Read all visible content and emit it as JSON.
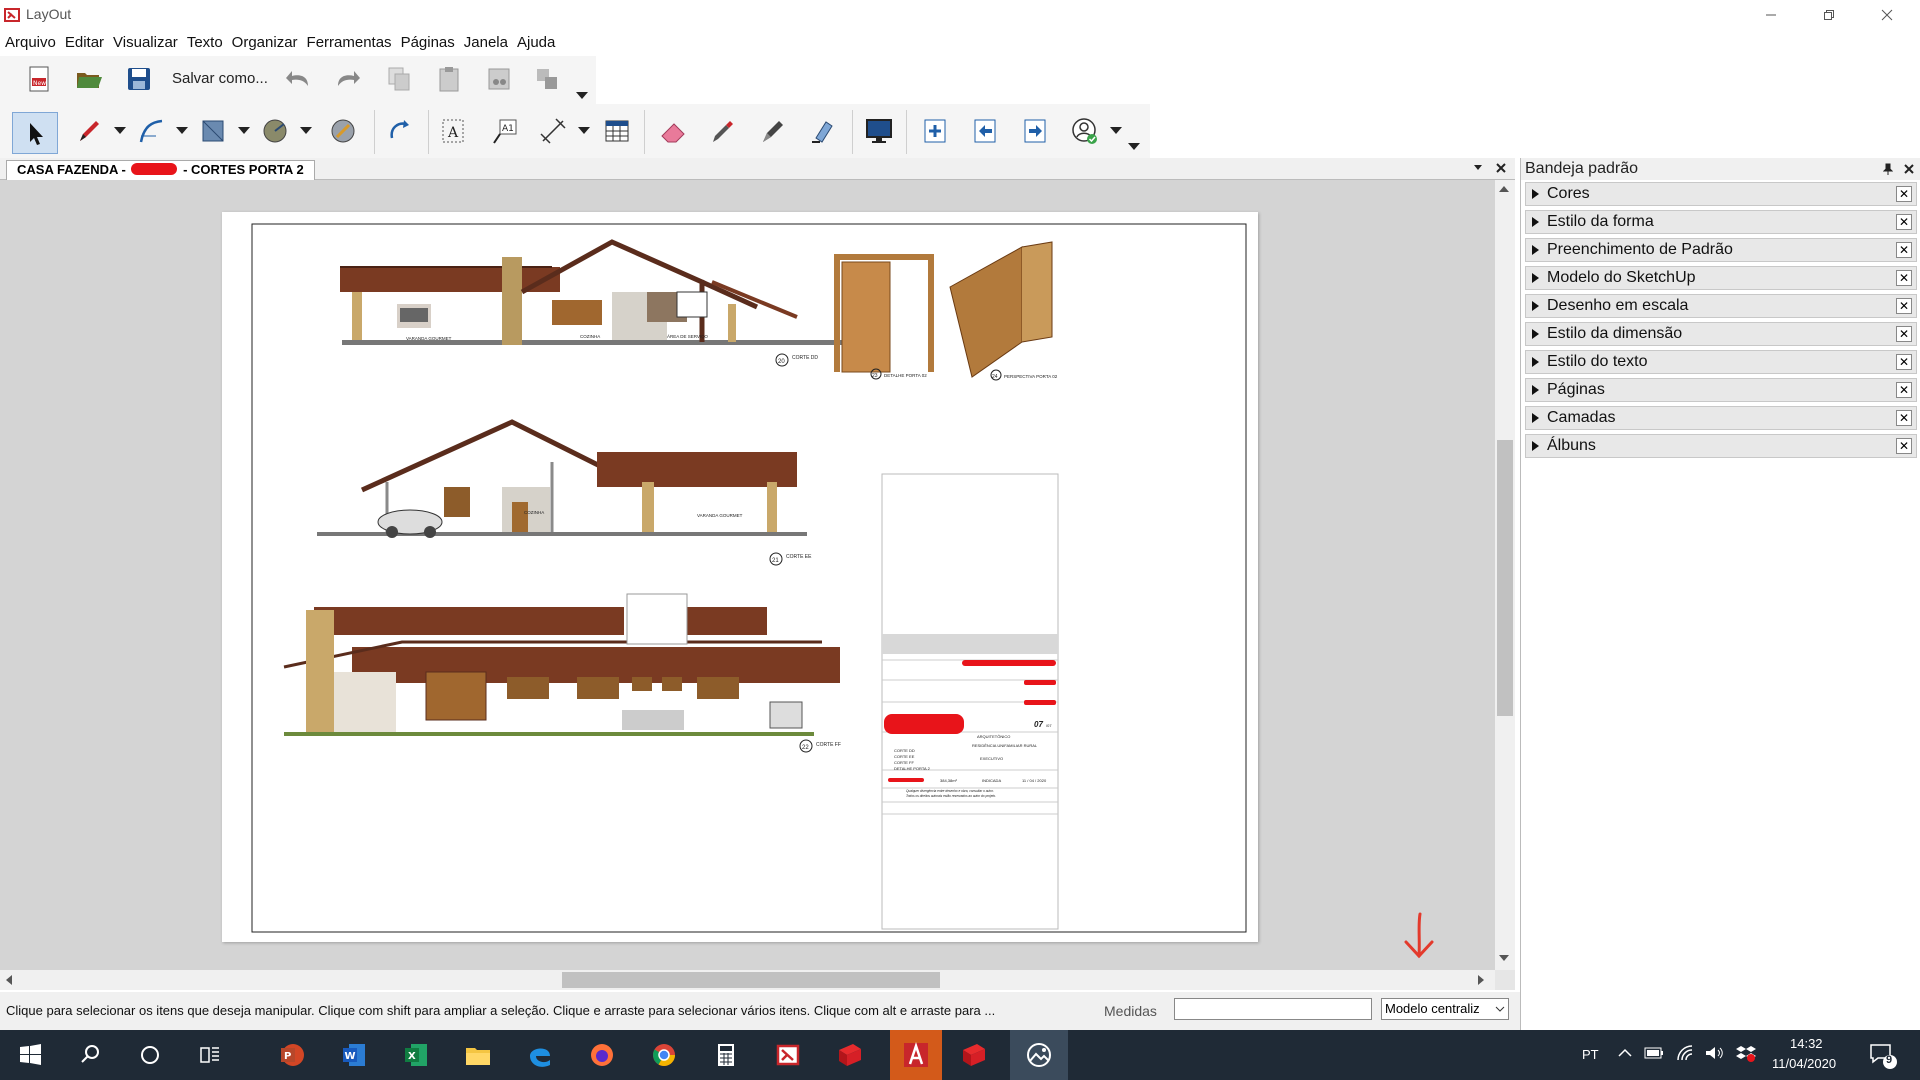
{
  "window": {
    "title": "LayOut"
  },
  "menu": [
    "Arquivo",
    "Editar",
    "Visualizar",
    "Texto",
    "Organizar",
    "Ferramentas",
    "Páginas",
    "Janela",
    "Ajuda"
  ],
  "toolbar": {
    "save_as_label": "Salvar como..."
  },
  "document": {
    "tab_left": "CASA FAZENDA -",
    "tab_right": "- CORTES PORTA 2"
  },
  "drawing": {
    "labels": {
      "varanda_gourmet": "VARANDA GOURMET",
      "cozinha": "COZINHA",
      "area_servico": "ÁREA DE SERVIÇO",
      "corte_dd": "CORTE DD",
      "corte_ee": "CORTE EE",
      "corte_ff": "CORTE FF",
      "detalhe_porta": "DETALHE PORTA 02",
      "perspectiva_porta": "PERSPECTIVA PORTA 02",
      "n20": "20",
      "n21": "21",
      "n22": "22",
      "n23": "23",
      "n24": "24",
      "sheet_no": "07",
      "sheet_total": "/07",
      "arquitetonico": "ARQUITETÔNICO",
      "residencia": "RESIDÊNCIA UNIFAMILIAR RURAL",
      "executivo": "EXECUTIVO",
      "contents": [
        "CORTE DD",
        "CORTE EE",
        "CORTE FF",
        "DETALHE PORTA 2"
      ],
      "area": "384,38m²",
      "escala": "INDICADA",
      "data": "11 / 04 / 2020",
      "note1": "Qualquer divergência entre desenho e obra, consultar o autor.",
      "note2": "Todos os direitos autorais estão reservados ao autor do projeto."
    }
  },
  "tray": {
    "title": "Bandeja padrão",
    "panels": [
      "Cores",
      "Estilo da forma",
      "Preenchimento de Padrão",
      "Modelo do SketchUp",
      "Desenho em escala",
      "Estilo da dimensão",
      "Estilo do texto",
      "Páginas",
      "Camadas",
      "Álbuns"
    ]
  },
  "status": {
    "message": "Clique para selecionar os itens que deseja manipular. Clique com shift para ampliar a seleção. Clique e arraste para selecionar vários itens. Clique com alt e arraste para ...",
    "measures_label": "Medidas",
    "measures_value": "",
    "mode": "Modelo centraliz"
  },
  "taskbar": {
    "lang": "PT",
    "time": "14:32",
    "date": "11/04/2020",
    "notifications": "9"
  },
  "colors": {
    "roof": "#7a3a22",
    "wood": "#b27a3c",
    "redact": "#e8141a",
    "taskbar": "#1f2a36",
    "annotation_arrow": "#e33a2c"
  }
}
